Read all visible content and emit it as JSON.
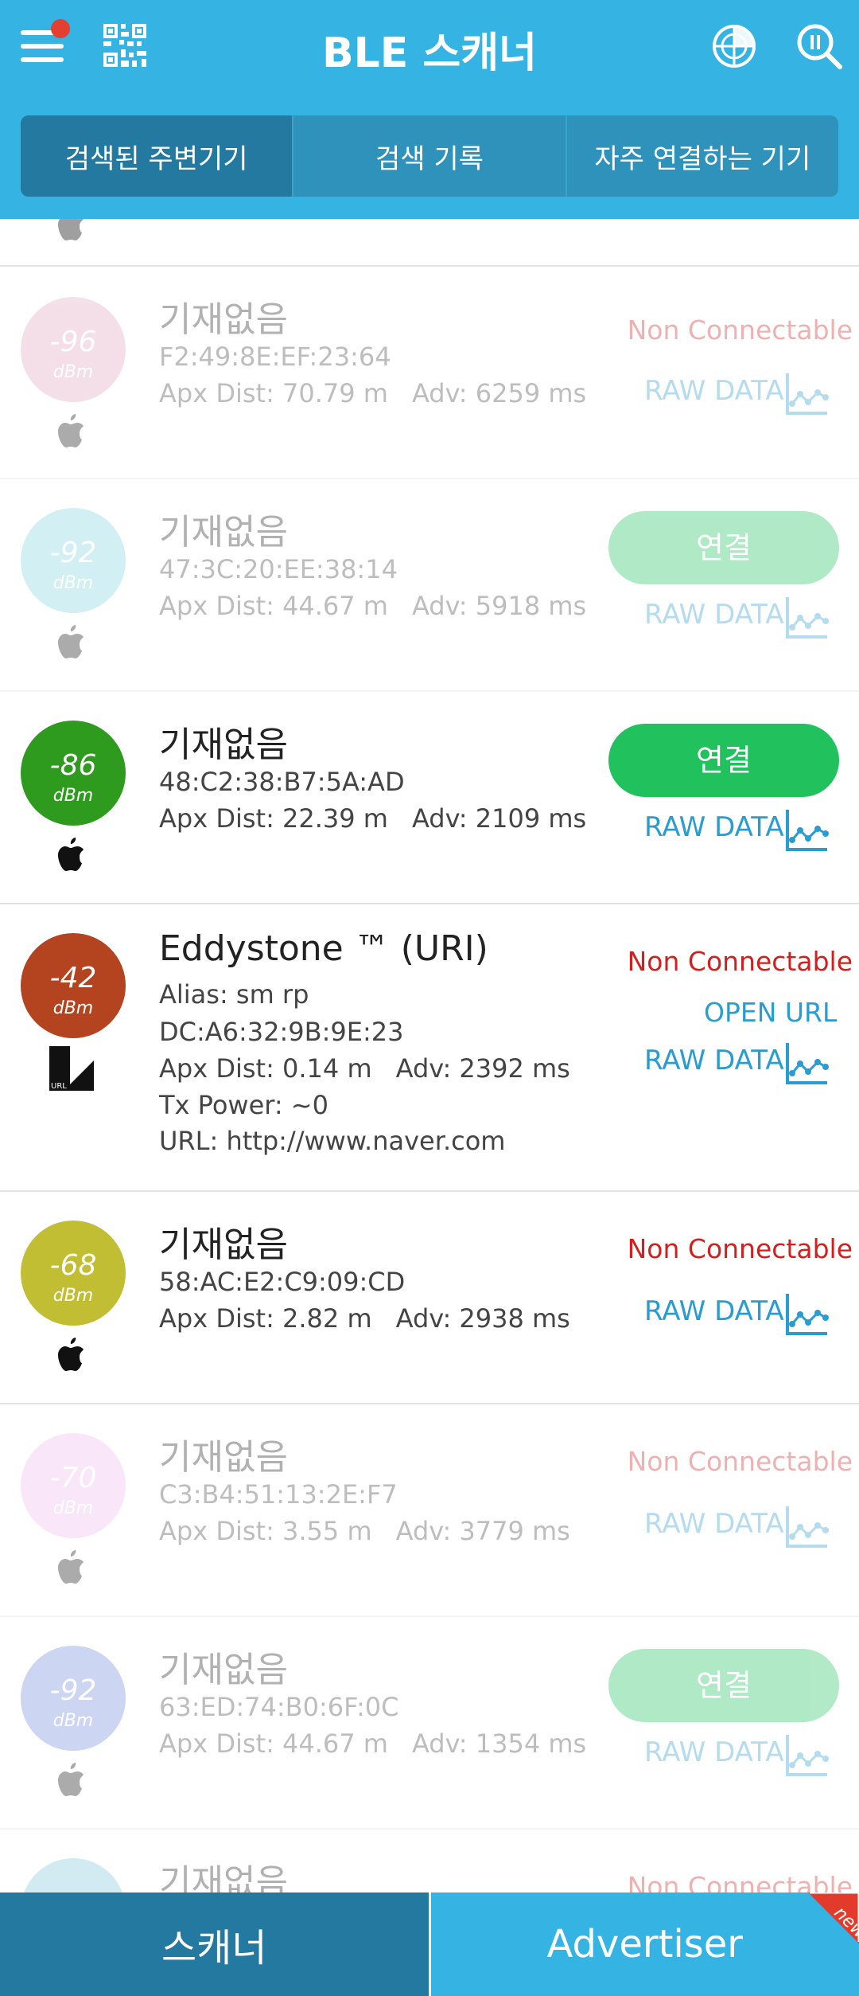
{
  "header": {
    "title": "BLE 스캐너",
    "accent": "#35b3e3"
  },
  "tabs": [
    {
      "label": "검색된 주변기기",
      "active": true
    },
    {
      "label": "검색 기록",
      "active": false
    },
    {
      "label": "자주 연결하는 기기",
      "active": false
    }
  ],
  "labels": {
    "unit": "dBm",
    "raw_data": "RAW DATA",
    "connect": "연결",
    "non_connectable": "Non Connectable",
    "open_url": "OPEN URL"
  },
  "devices": [
    {
      "name": "기재없음",
      "rssi": "-96",
      "color": "#e0a5c0",
      "dim": true,
      "mac": "F2:49:8E:EF:23:64",
      "dist": "Apx Dist: 70.79 m",
      "adv": "Adv: 6259 ms",
      "status": "Non Connectable",
      "brand_icon": "apple-icon"
    },
    {
      "name": "기재없음",
      "rssi": "-92",
      "color": "#7fd4de",
      "dim": true,
      "mac": "47:3C:20:EE:38:14",
      "dist": "Apx Dist: 44.67 m",
      "adv": "Adv: 5918 ms",
      "status": "연결",
      "brand_icon": "apple-icon"
    },
    {
      "name": "기재없음",
      "rssi": "-86",
      "color": "#2e9b1e",
      "dim": false,
      "mac": "48:C2:38:B7:5A:AD",
      "dist": "Apx Dist: 22.39 m",
      "adv": "Adv: 2109 ms",
      "status": "연결",
      "brand_icon": "apple-icon"
    },
    {
      "name": "Eddystone ™ (URI)",
      "rssi": "-42",
      "color": "#b4431f",
      "dim": false,
      "alias": "Alias: sm rp",
      "mac": "DC:A6:32:9B:9E:23",
      "dist": "Apx Dist: 0.14 m",
      "adv": "Adv: 2392 ms",
      "tx": "Tx Power: ~0",
      "url": "URL: http://www.naver.com",
      "status": "Non Connectable",
      "brand_icon": "eddystone-url-icon"
    },
    {
      "name": "기재없음",
      "rssi": "-68",
      "color": "#c2be33",
      "dim": false,
      "mac": "58:AC:E2:C9:09:CD",
      "dist": "Apx Dist: 2.82 m",
      "adv": "Adv: 2938 ms",
      "status": "Non Connectable",
      "brand_icon": "apple-icon"
    },
    {
      "name": "기재없음",
      "rssi": "-70",
      "color": "#f0b9ec",
      "dim": true,
      "mac": "C3:B4:51:13:2E:F7",
      "dist": "Apx Dist: 3.55 m",
      "adv": "Adv: 3779 ms",
      "status": "Non Connectable",
      "brand_icon": "apple-icon"
    },
    {
      "name": "기재없음",
      "rssi": "-92",
      "color": "#6f8ad8",
      "dim": true,
      "mac": "63:ED:74:B0:6F:0C",
      "dist": "Apx Dist: 44.67 m",
      "adv": "Adv: 1354 ms",
      "status": "연결",
      "brand_icon": "apple-icon"
    },
    {
      "name": "기재없음",
      "rssi": "",
      "color": "#7fc4d8",
      "dim": true,
      "status": "Non Connectable"
    }
  ],
  "bottom_tabs": {
    "scanner": "스캐너",
    "advertiser": "Advertiser",
    "badge": "new"
  }
}
